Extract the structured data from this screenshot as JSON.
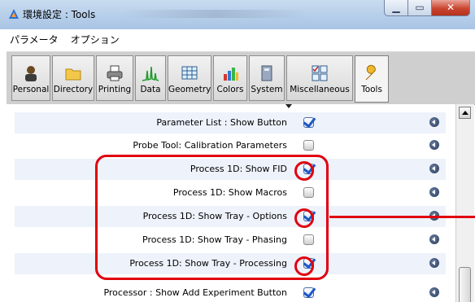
{
  "window": {
    "title": "環境設定 : Tools",
    "controls": {
      "minimize": "▁",
      "maximize": "▭",
      "close": "✕"
    }
  },
  "menu": {
    "items": [
      "パラメータ",
      "オプション"
    ]
  },
  "toolbar": {
    "buttons": [
      {
        "label": "Personal",
        "icon": "person-icon"
      },
      {
        "label": "Directory",
        "icon": "folder-icon"
      },
      {
        "label": "Printing",
        "icon": "printer-icon"
      },
      {
        "label": "Data",
        "icon": "spectrum-icon"
      },
      {
        "label": "Geometry",
        "icon": "grid-icon"
      },
      {
        "label": "Colors",
        "icon": "palette-icon"
      },
      {
        "label": "System",
        "icon": "system-icon"
      },
      {
        "label": "Miscellaneous",
        "icon": "misc-icon"
      },
      {
        "label": "Tools",
        "icon": "wrench-icon",
        "active": true
      }
    ]
  },
  "settings": {
    "rows": [
      {
        "label": "Parameter List : Show Button",
        "checked": true
      },
      {
        "label": "Probe Tool: Calibration Parameters",
        "checked": false
      },
      {
        "label": "Process 1D: Show FID",
        "checked": true
      },
      {
        "label": "Process 1D: Show Macros",
        "checked": false
      },
      {
        "label": "Process 1D: Show Tray - Options",
        "checked": true
      },
      {
        "label": "Process 1D: Show Tray - Phasing",
        "checked": false
      },
      {
        "label": "Process 1D: Show Tray - Processing",
        "checked": true
      },
      {
        "label": "Processor : Show Add Experiment Button",
        "checked": true
      }
    ]
  },
  "colors": {
    "annotation": "#e0000f",
    "check_mark": "#1f57c4",
    "row_alt": "#eef2fb"
  }
}
